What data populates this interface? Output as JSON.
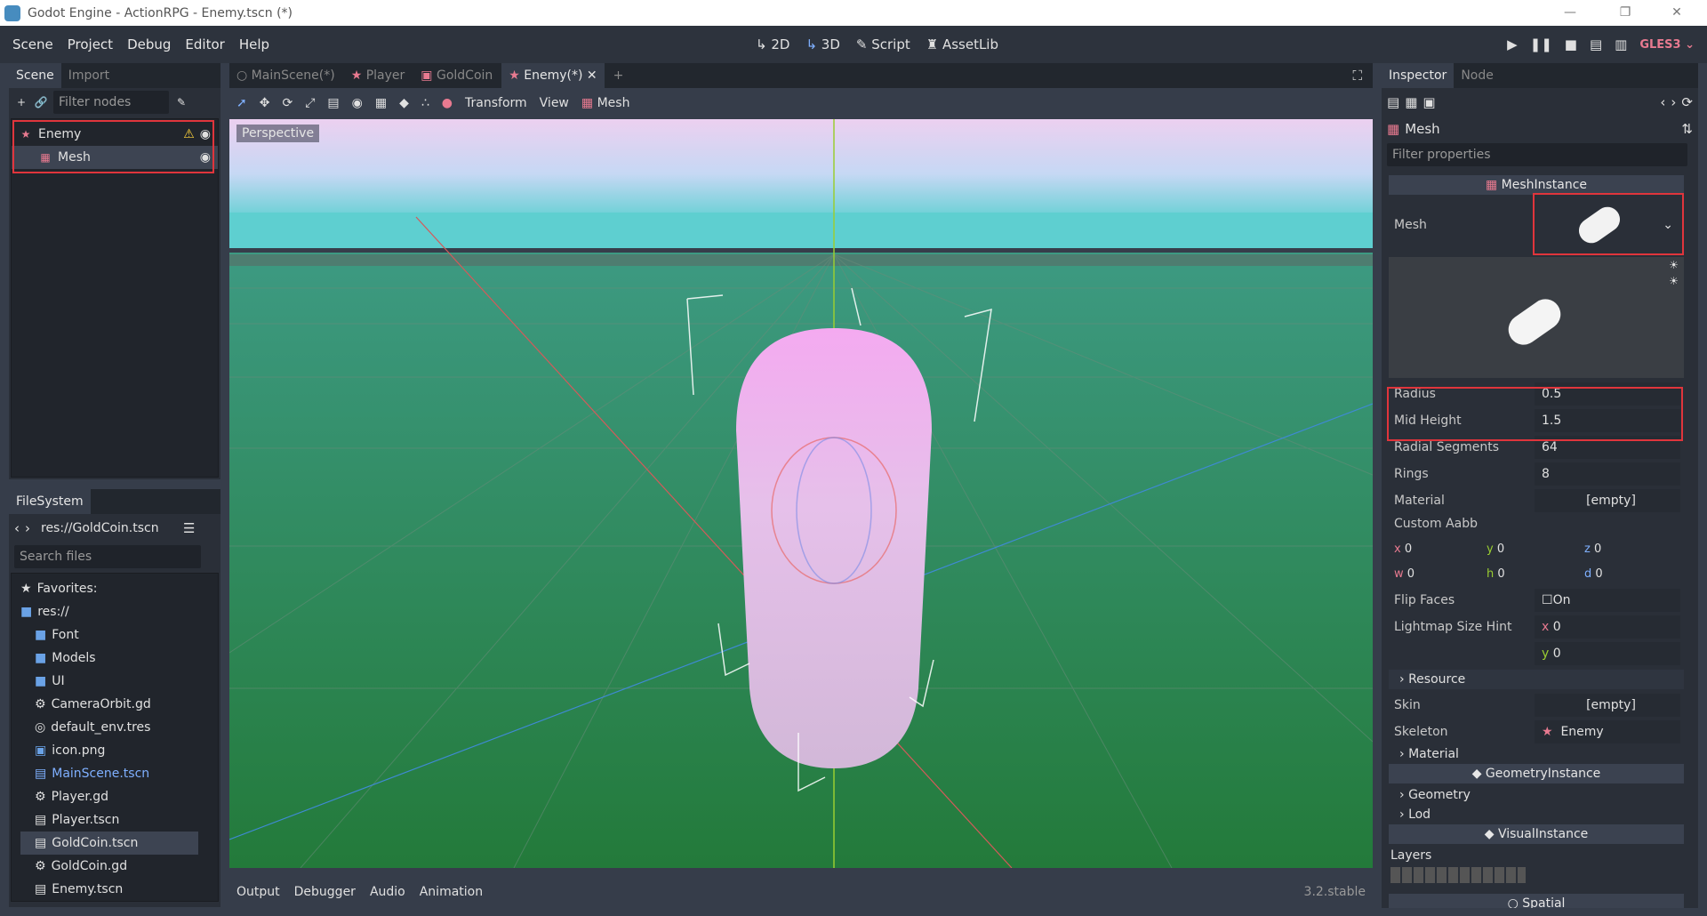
{
  "window": {
    "title": "Godot Engine - ActionRPG - Enemy.tscn (*)"
  },
  "menu": {
    "items": [
      "Scene",
      "Project",
      "Debug",
      "Editor",
      "Help"
    ]
  },
  "modes": {
    "m2d": "2D",
    "m3d": "3D",
    "script": "Script",
    "assetlib": "AssetLib"
  },
  "renderer": "GLES3",
  "scene_dock": {
    "tab_scene": "Scene",
    "tab_import": "Import",
    "filter_placeholder": "Filter nodes",
    "nodes": [
      {
        "label": "Enemy"
      },
      {
        "label": "Mesh"
      }
    ]
  },
  "filesystem": {
    "tab": "FileSystem",
    "path": "res://GoldCoin.tscn",
    "search_placeholder": "Search files",
    "favorites": "Favorites:",
    "root": "res://",
    "items": [
      "Font",
      "Models",
      "UI",
      "CameraOrbit.gd",
      "default_env.tres",
      "icon.png",
      "MainScene.tscn",
      "Player.gd",
      "Player.tscn",
      "GoldCoin.tscn",
      "GoldCoin.gd",
      "Enemy.tscn"
    ]
  },
  "editor_tabs": [
    "MainScene(*)",
    "Player",
    "GoldCoin",
    "Enemy(*)"
  ],
  "viewport_toolbar": {
    "transform": "Transform",
    "view": "View",
    "mesh": "Mesh"
  },
  "viewport": {
    "perspective": "Perspective"
  },
  "bottom_panel": {
    "tabs": [
      "Output",
      "Debugger",
      "Audio",
      "Animation"
    ],
    "version": "3.2.stable"
  },
  "inspector": {
    "tab_inspector": "Inspector",
    "tab_node": "Node",
    "object": "Mesh",
    "filter_placeholder": "Filter properties",
    "section": "MeshInstance",
    "mesh_label": "Mesh",
    "radius_label": "Radius",
    "radius": "0.5",
    "mid_height_label": "Mid Height",
    "mid_height": "1.5",
    "radial_segments_label": "Radial Segments",
    "radial_segments": "64",
    "rings_label": "Rings",
    "rings": "8",
    "material_label": "Material",
    "material": "[empty]",
    "custom_aabb_label": "Custom Aabb",
    "aabb": {
      "x": "0",
      "y": "0",
      "z": "0",
      "w": "0",
      "h": "0",
      "d": "0"
    },
    "flip_faces_label": "Flip Faces",
    "flip_faces": "On",
    "lightmap_label": "Lightmap Size Hint",
    "lm_x": "0",
    "lm_y": "0",
    "resource": "Resource",
    "skin_label": "Skin",
    "skin": "[empty]",
    "skeleton_label": "Skeleton",
    "skeleton": "Enemy",
    "material_sub": "Material",
    "geometry_instance": "GeometryInstance",
    "geometry": "Geometry",
    "lod": "Lod",
    "visual_instance": "VisualInstance",
    "layers_label": "Layers",
    "spatial": "Spatial"
  }
}
